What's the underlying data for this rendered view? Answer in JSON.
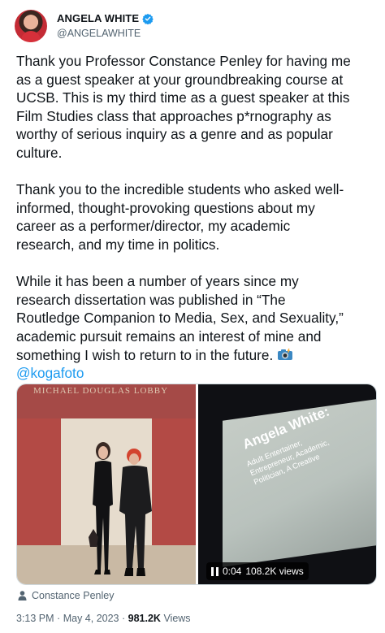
{
  "author": {
    "name": "ANGELA WHITE",
    "handle": "@ANGELAWHITE",
    "verified_color": "#1d9bf0"
  },
  "tweet": {
    "paragraphs": [
      "Thank you Professor Constance Penley for having me\nas a guest speaker at your groundbreaking course at\nUCSB. This is my third time as a guest speaker at this\nFilm Studies class that approaches p*rnography as\nworthy of serious inquiry as a genre and as popular\nculture.",
      "Thank you to the incredible students who asked well-\ninformed, thought-provoking questions about my\ncareer as a performer/director, my academic\nresearch, and my time in politics.",
      "While it has been a number of years since my\nresearch dissertation was published in “The\nRoutledge Companion to Media, Sex, and Sexuality,”\nacademic pursuit remains an interest of mine and\nsomething I wish to return to in the future."
    ],
    "emoji_icon": "camera-with-flash-icon",
    "mention": "@kogafoto",
    "link_color": "#1d9bf0"
  },
  "media": {
    "photo_sign": "MICHAEL DOUGLAS LOBBY",
    "slide_title": "Angela White:",
    "slide_subtitle": "Adult Entertainer,\nEntrepreneur, Academic,\nPolitician, A Creative",
    "video_time": "0:04",
    "video_views": "108.2K views"
  },
  "tagged": {
    "icon": "person-icon",
    "name": "Constance Penley"
  },
  "meta": {
    "time": "3:13 PM",
    "separator": "·",
    "date": "May 4, 2023",
    "views_count": "981.2K",
    "views_label": "Views"
  }
}
